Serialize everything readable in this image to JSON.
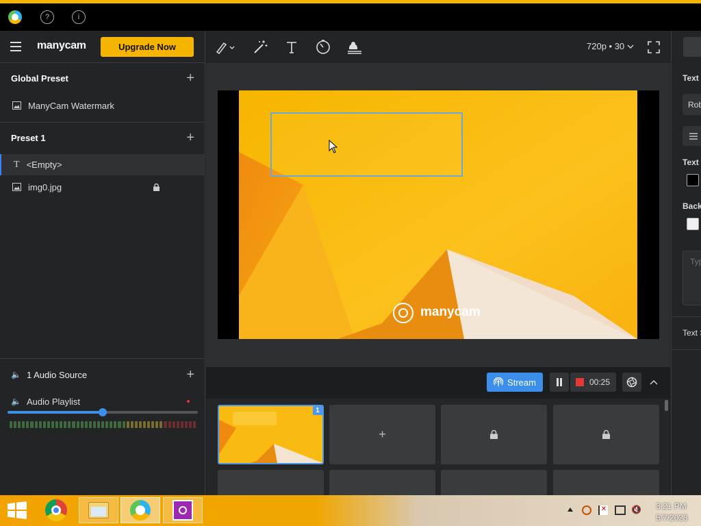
{
  "app": {
    "logo": "manycam",
    "upgrade_label": "Upgrade Now",
    "accent": "#f5b400"
  },
  "sidebar": {
    "global_preset": {
      "title": "Global Preset",
      "items": [
        {
          "label": "ManyCam Watermark",
          "icon": "image-icon"
        }
      ]
    },
    "preset1": {
      "title": "Preset 1",
      "items": [
        {
          "label": "<Empty>",
          "icon": "text-icon",
          "selected": true
        },
        {
          "label": "img0.jpg",
          "icon": "image-icon",
          "locked": true
        }
      ]
    },
    "audio": {
      "title": "1 Audio Source",
      "items": [
        {
          "label": "Audio Playlist"
        }
      ],
      "volume": 0.5
    }
  },
  "toolbar": {
    "resolution": "720p • 30"
  },
  "controls": {
    "stream_label": "Stream",
    "timer": "00:25"
  },
  "grid": {
    "first_badge": "1",
    "add_symbol": "+"
  },
  "right_panel": {
    "text_label": "Text",
    "font_value": "Rob",
    "text_color_label": "Text c",
    "background_label": "Back",
    "textarea_placeholder": "Typ",
    "text_style_label": "Text S"
  },
  "preview": {
    "watermark": "manycam"
  },
  "taskbar": {
    "time": "3:21 PM",
    "date": "5/7/2023"
  }
}
